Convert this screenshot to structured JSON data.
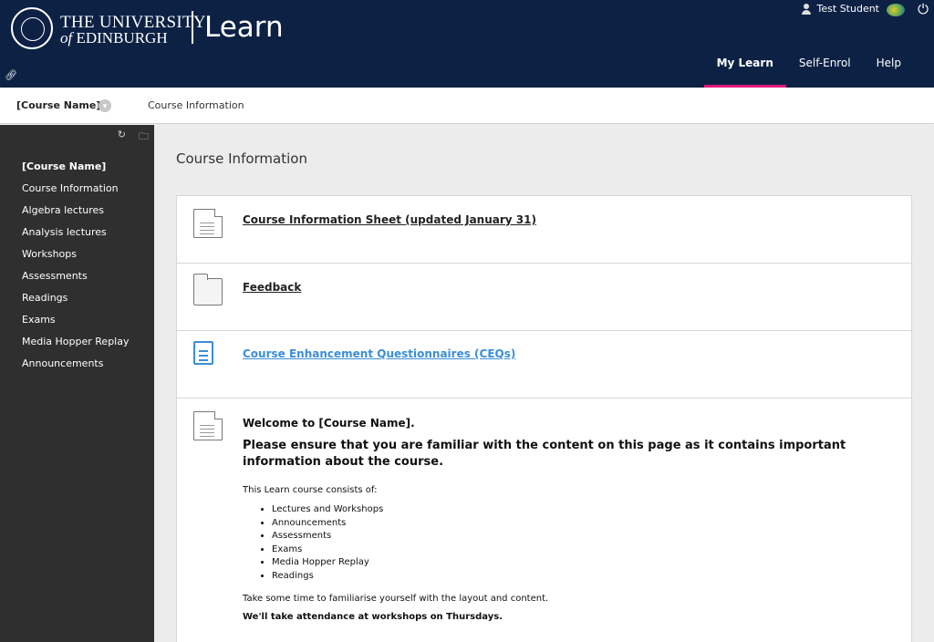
{
  "header": {
    "university_line1": "THE UNIVERSITY",
    "university_line2_of": "of",
    "university_line2_name": "EDINBURGH",
    "app_name": "Learn",
    "link_icon": "link-icon",
    "user": {
      "name": "Test Student",
      "icon": "user-icon"
    },
    "avatar_icon": "avatar-icon",
    "power_icon": "power-icon",
    "nav": [
      {
        "label": "My Learn",
        "active": true
      },
      {
        "label": "Self-Enrol",
        "active": false
      },
      {
        "label": "Help",
        "active": false
      }
    ],
    "colors": {
      "background": "#0c2144",
      "active_underline": "#e2187f"
    }
  },
  "breadcrumb": {
    "course": "[Course Name]",
    "page": "Course Information",
    "toggle_icon": "chevron-down-icon"
  },
  "sidebar": {
    "tools": [
      "refresh-icon",
      "folder-icon"
    ],
    "items": [
      {
        "label": "[Course Name]",
        "is_title": true
      },
      {
        "label": "Course Information"
      },
      {
        "label": "Algebra lectures"
      },
      {
        "label": "Analysis lectures"
      },
      {
        "label": "Workshops"
      },
      {
        "label": "Assessments"
      },
      {
        "label": "Readings"
      },
      {
        "label": "Exams"
      },
      {
        "label": "Media Hopper Replay"
      },
      {
        "label": "Announcements"
      }
    ]
  },
  "content": {
    "title": "Course Information",
    "items": [
      {
        "type": "document",
        "icon": "document-icon",
        "link": "Course Information Sheet (updated January 31)"
      },
      {
        "type": "folder",
        "icon": "folder-icon",
        "link": "Feedback"
      },
      {
        "type": "survey",
        "icon": "form-icon",
        "link": "Course Enhancement Questionnaires (CEQs)"
      }
    ],
    "welcome": {
      "icon": "document-icon",
      "heading": "Welcome to [Course Name].",
      "subheading": "Please ensure that you are familiar with the content on this page as it contains important information about the course.",
      "intro": "This Learn course consists of:",
      "list": [
        "Lectures and Workshops",
        "Announcements",
        "Assessments",
        "Exams",
        "Media Hopper Replay",
        "Readings"
      ],
      "familiarise": "Take some time to familiarise yourself with the layout and content.",
      "attendance": "We'll take attendance at workshops on Thursdays."
    }
  }
}
